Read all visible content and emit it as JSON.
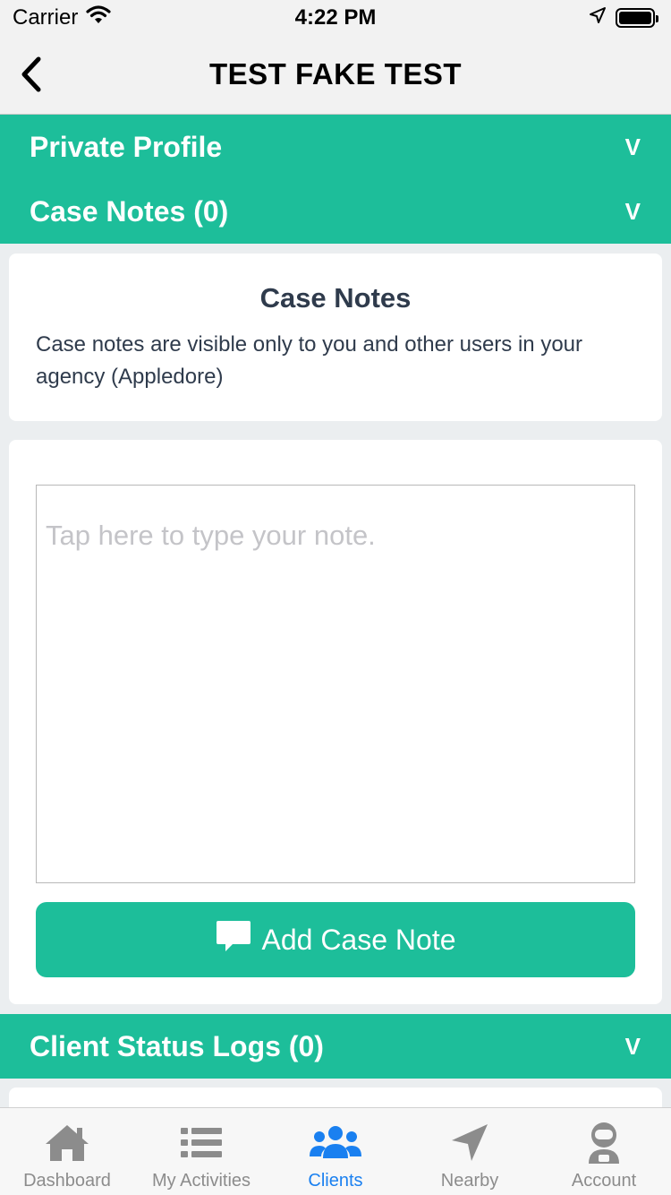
{
  "status_bar": {
    "carrier": "Carrier",
    "time": "4:22 PM"
  },
  "nav": {
    "title": "TEST FAKE TEST",
    "back_icon": "chevron-left-icon"
  },
  "sections": {
    "private_profile": {
      "label": "Private Profile",
      "chevron": "V"
    },
    "case_notes": {
      "label": "Case Notes (0)",
      "chevron": "V"
    },
    "client_status_logs": {
      "label": "Client Status Logs (0)",
      "chevron": "V"
    }
  },
  "case_notes_info": {
    "title": "Case Notes",
    "description": "Case notes are visible only to you and other users in your agency (Appledore)"
  },
  "note_editor": {
    "placeholder": "Tap here to type your note.",
    "value": "",
    "add_button_label": "Add Case Note",
    "add_button_icon": "speech-bubble-icon"
  },
  "tab_bar": {
    "tabs": [
      {
        "label": "Dashboard",
        "icon": "home-icon",
        "active": false
      },
      {
        "label": "My Activities",
        "icon": "list-icon",
        "active": false
      },
      {
        "label": "Clients",
        "icon": "users-icon",
        "active": true
      },
      {
        "label": "Nearby",
        "icon": "location-arrow-icon",
        "active": false
      },
      {
        "label": "Account",
        "icon": "astronaut-icon",
        "active": false
      }
    ]
  },
  "colors": {
    "accent": "#1dbe9a",
    "active_tab": "#1a80f0",
    "inactive_tab": "#8c8c8c",
    "text_dark": "#2f3b4c"
  }
}
